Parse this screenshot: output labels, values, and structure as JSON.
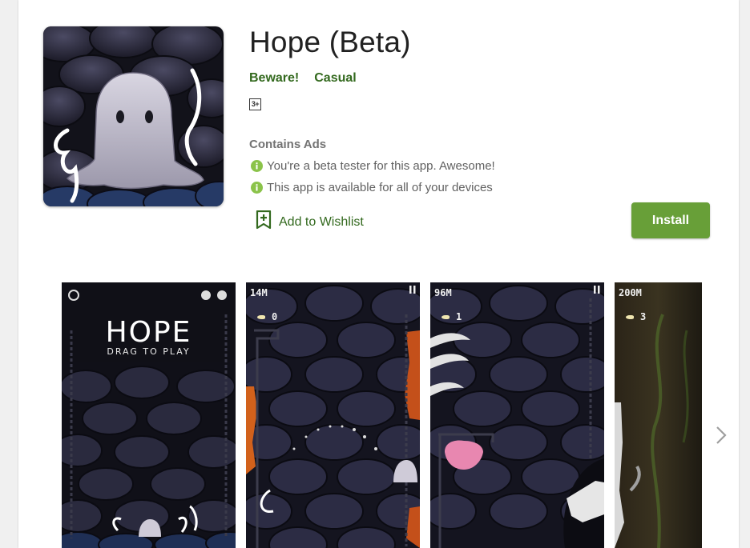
{
  "app": {
    "title": "Hope (Beta)",
    "tags": [
      "Beware!",
      "Casual"
    ],
    "content_rating": "3+",
    "contains_ads": "Contains Ads",
    "info_lines": [
      "You're a beta tester for this app. Awesome!",
      "This app is available for all of your devices"
    ],
    "wishlist_label": "Add to Wishlist",
    "install_label": "Install"
  },
  "screenshots": [
    {
      "logo": "HOPE",
      "subtitle": "DRAG TO PLAY"
    },
    {
      "distance": "14M",
      "count": "0"
    },
    {
      "distance": "96M",
      "count": "1"
    },
    {
      "distance": "200M",
      "count": "3"
    }
  ],
  "icons": {
    "info": "info-circle-icon",
    "wishlist": "bookmark-plus-icon",
    "next": "chevron-right-icon"
  },
  "colors": {
    "accent_green": "#689f38",
    "tag_green": "#33691e",
    "info_dot": "#8bc34a",
    "scene_dark": "#1c1c2c"
  }
}
